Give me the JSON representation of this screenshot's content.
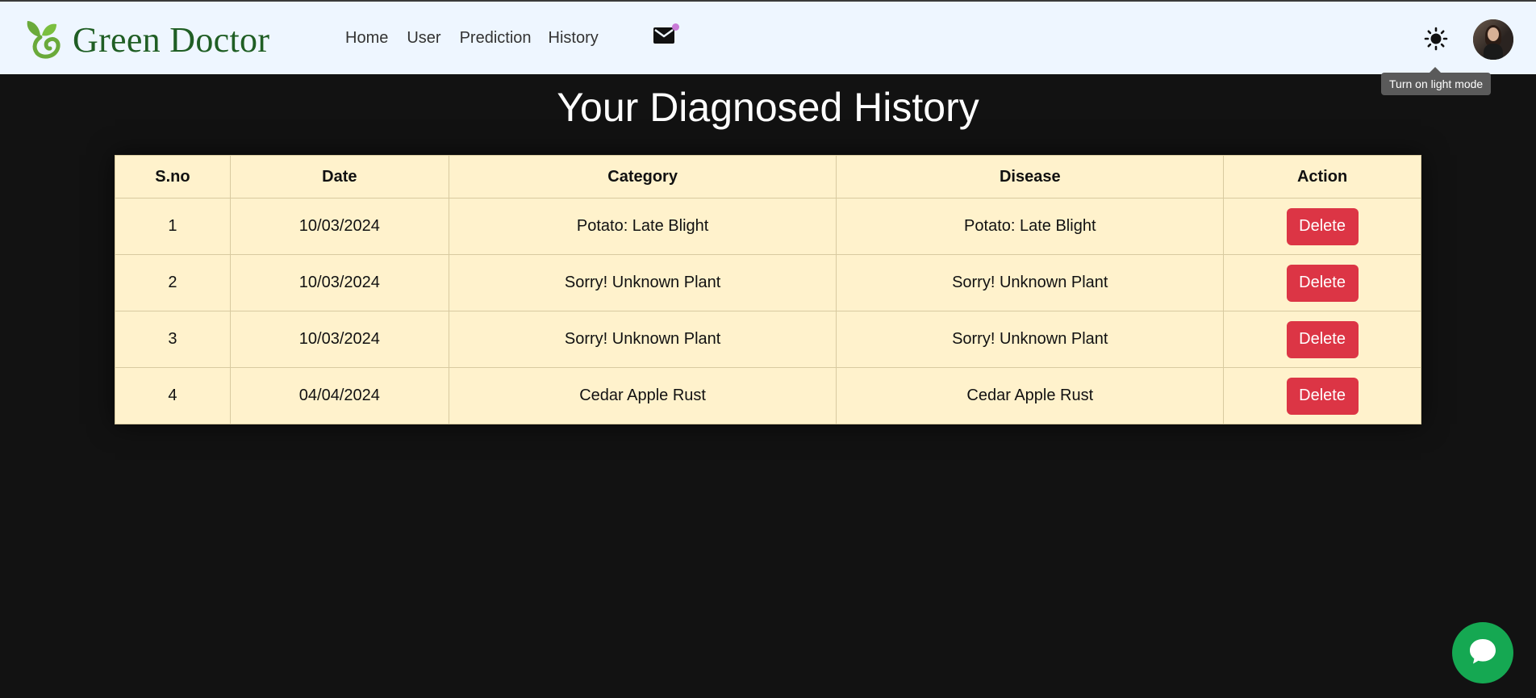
{
  "brand": {
    "name": "Green Doctor"
  },
  "nav": {
    "links": [
      {
        "label": "Home"
      },
      {
        "label": "User"
      },
      {
        "label": "Prediction"
      },
      {
        "label": "History"
      }
    ],
    "mail_icon": "envelope-icon",
    "theme_icon": "sun-icon",
    "tooltip": "Turn on light mode"
  },
  "page": {
    "title": "Your Diagnosed History"
  },
  "table": {
    "headers": [
      "S.no",
      "Date",
      "Category",
      "Disease",
      "Action"
    ],
    "rows": [
      {
        "sno": "1",
        "date": "10/03/2024",
        "category": "Potato: Late Blight",
        "disease": "Potato: Late Blight",
        "action": "Delete"
      },
      {
        "sno": "2",
        "date": "10/03/2024",
        "category": "Sorry! Unknown Plant",
        "disease": "Sorry! Unknown Plant",
        "action": "Delete"
      },
      {
        "sno": "3",
        "date": "10/03/2024",
        "category": "Sorry! Unknown Plant",
        "disease": "Sorry! Unknown Plant",
        "action": "Delete"
      },
      {
        "sno": "4",
        "date": "04/04/2024",
        "category": "Cedar Apple Rust",
        "disease": "Cedar Apple Rust",
        "action": "Delete"
      }
    ]
  },
  "colors": {
    "navbar_bg": "#eef6ff",
    "page_bg": "#121212",
    "table_bg": "#fff2cc",
    "delete_button": "#dc3545",
    "chat_button": "#15a852",
    "brand_text": "#1f5e24"
  },
  "chat": {
    "icon": "chat-bubble-icon"
  }
}
